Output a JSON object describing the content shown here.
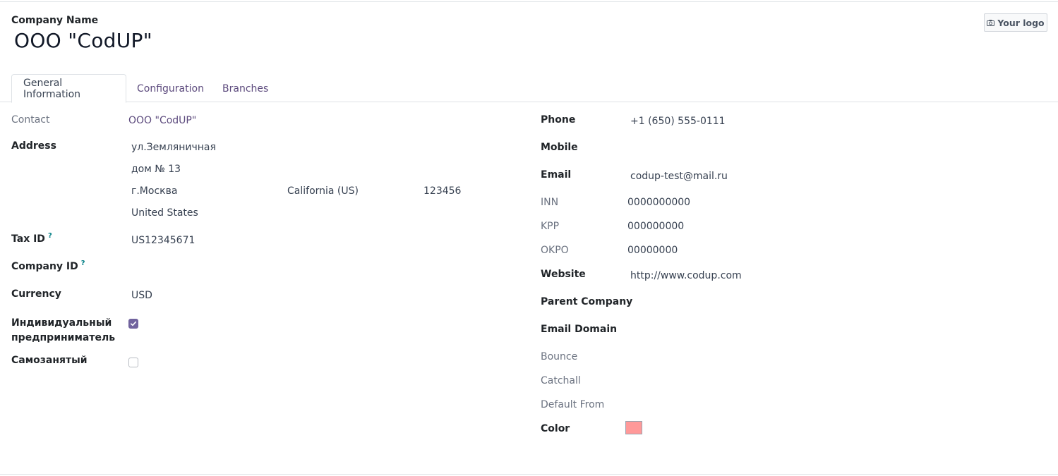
{
  "header": {
    "company_label": "Company Name",
    "company_name": "OOO \"CodUP\"",
    "logo_button": "Your logo"
  },
  "tabs": [
    {
      "label": "General Information",
      "active": true
    },
    {
      "label": "Configuration",
      "active": false
    },
    {
      "label": "Branches",
      "active": false
    }
  ],
  "left": {
    "contact_label": "Contact",
    "contact_value": "OOO \"CodUP\"",
    "address_label": "Address",
    "street": "ул.Земляничная",
    "street2": "дом № 13",
    "city": "г.Москва",
    "state": "California (US)",
    "zip": "123456",
    "country": "United States",
    "tax_id_label": "Tax ID",
    "tax_id_help": "?",
    "tax_id_value": "US12345671",
    "company_id_label": "Company ID",
    "company_id_help": "?",
    "currency_label": "Currency",
    "currency_value": "USD",
    "ip_label_line1": "Индивидуальный",
    "ip_label_line2": "предприниматель",
    "ip_checked": true,
    "self_employed_label": "Самозанятый",
    "self_employed_checked": false
  },
  "right": {
    "phone_label": "Phone",
    "phone_value": "+1 (650) 555-0111",
    "mobile_label": "Mobile",
    "email_label": "Email",
    "email_value": "codup-test@mail.ru",
    "inn_label": "INN",
    "inn_value": "0000000000",
    "kpp_label": "KPP",
    "kpp_value": "000000000",
    "okpo_label": "OKPO",
    "okpo_value": "00000000",
    "website_label": "Website",
    "website_value": "http://www.codup.com",
    "parent_company_label": "Parent Company",
    "email_domain_label": "Email Domain",
    "bounce_label": "Bounce",
    "catchall_label": "Catchall",
    "default_from_label": "Default From",
    "color_label": "Color",
    "color_value": "#ff9999"
  },
  "colors": {
    "accent": "#71639e",
    "link": "#5c4a7d",
    "help": "#017e84"
  },
  "icons": {
    "logo_button_icon": "camera-icon",
    "checkbox_check": "checkmark-icon"
  }
}
